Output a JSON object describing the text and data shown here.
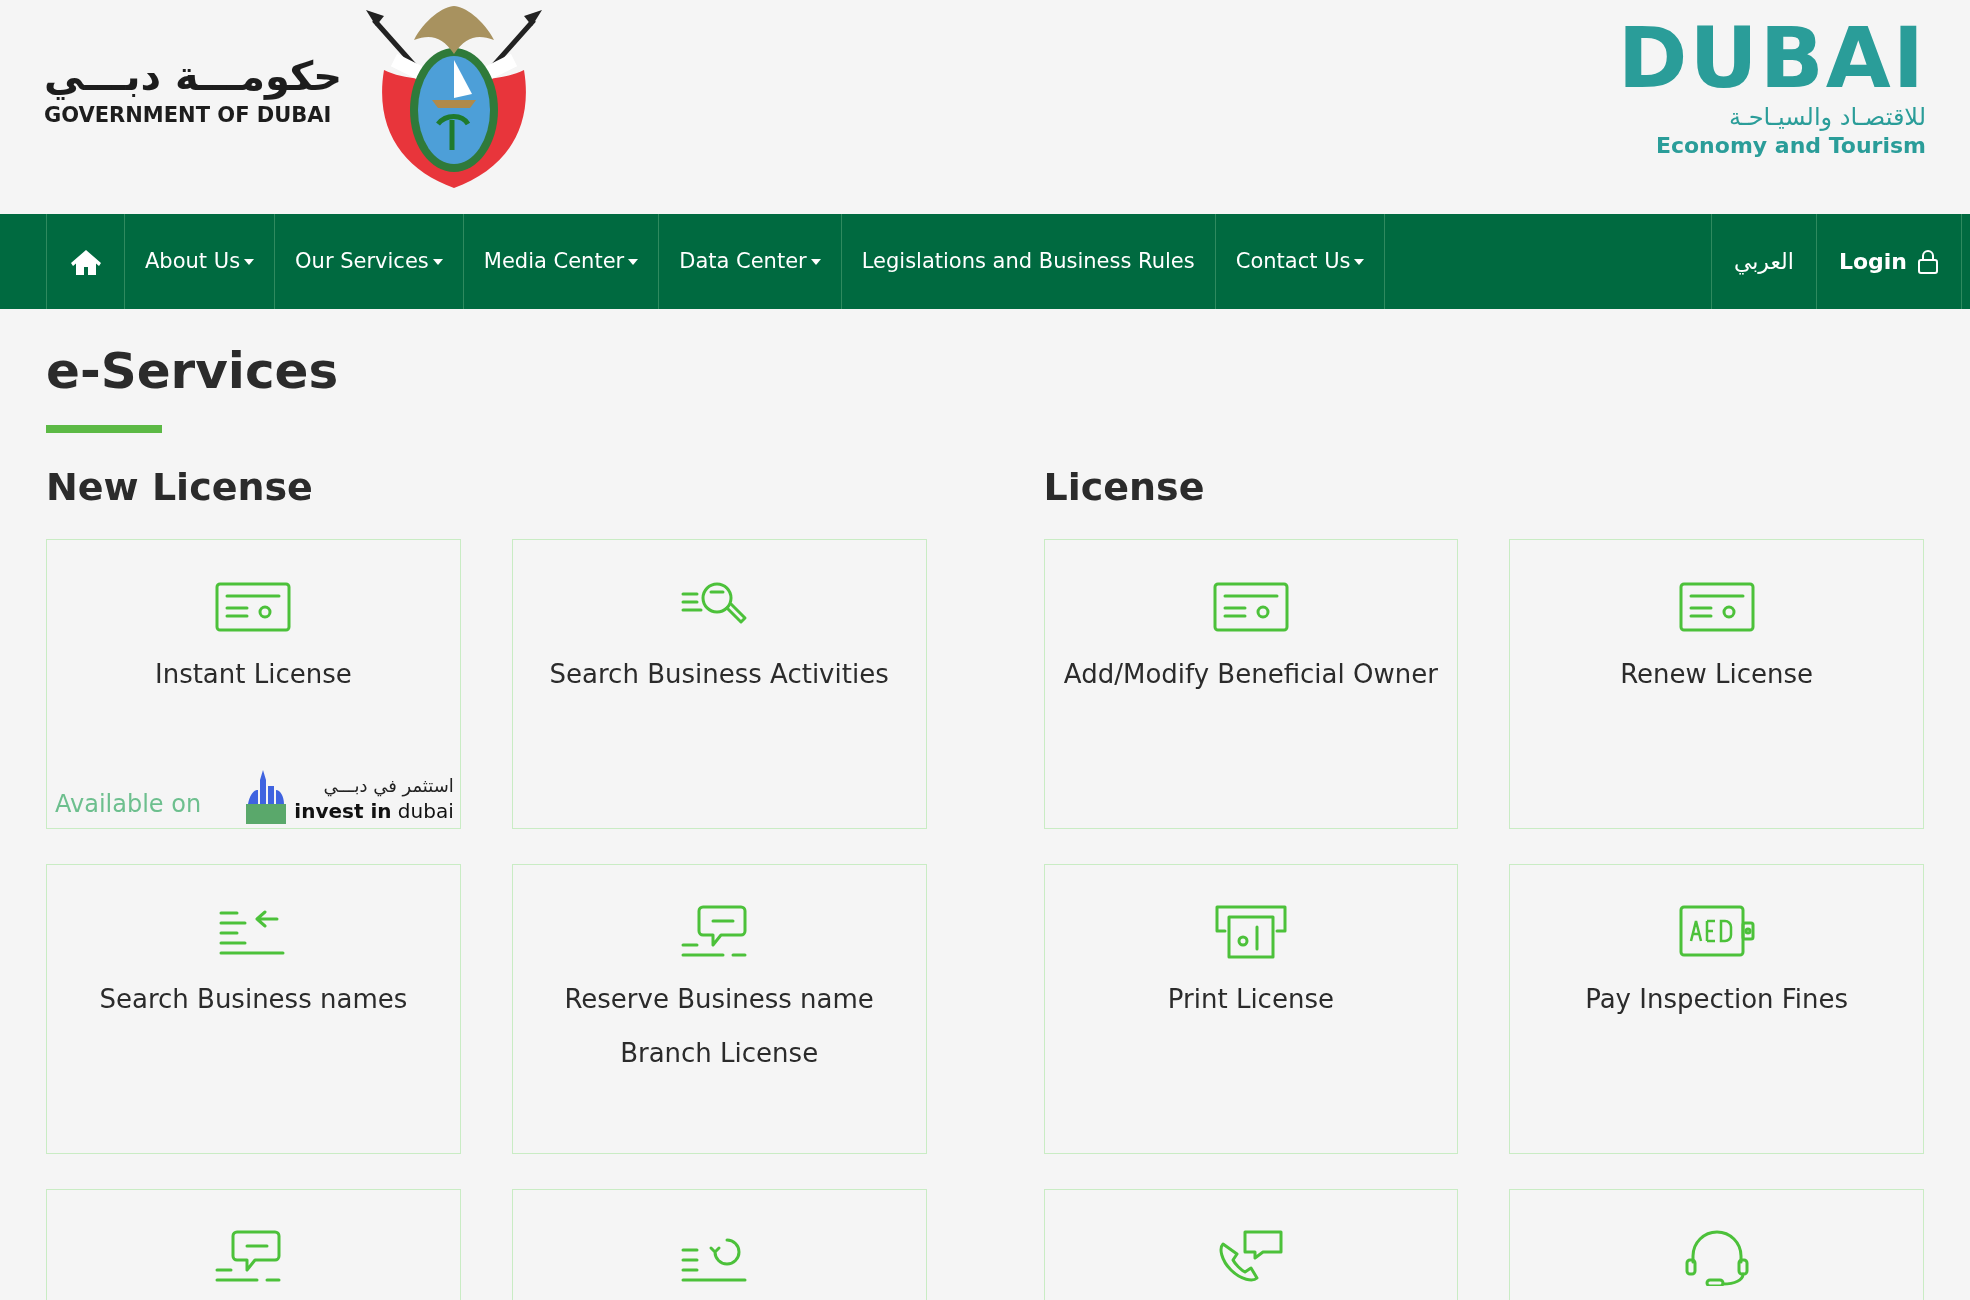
{
  "header": {
    "gov_logo": {
      "arabic": "حكومـــة دبـــي",
      "english": "GOVERNMENT OF DUBAI"
    },
    "det_logo": {
      "wordmark": "DUBAI",
      "arabic": "للاقتصـاد والسيـاحـة",
      "english": "Economy and Tourism"
    }
  },
  "nav": {
    "items": [
      {
        "label": "About Us",
        "dropdown": true
      },
      {
        "label": "Our Services",
        "dropdown": true
      },
      {
        "label": "Media Center",
        "dropdown": true
      },
      {
        "label": "Data Center",
        "dropdown": true
      },
      {
        "label": "Legislations and Business Rules",
        "dropdown": false
      },
      {
        "label": "Contact Us",
        "dropdown": true
      }
    ],
    "language": "العربي",
    "login": "Login"
  },
  "page_title": "e-Services",
  "sections": [
    {
      "title": "New License",
      "cards": [
        {
          "kind": "license",
          "lines": [
            "Instant License"
          ],
          "badge": {
            "prefix": "Available on",
            "arabic": "استثمر في دبـــي",
            "brand": "**invest in** dubai"
          }
        },
        {
          "kind": "search",
          "lines": [
            "Search Business Activities"
          ]
        },
        {
          "kind": "listArrow",
          "lines": [
            "Search Business names"
          ]
        },
        {
          "kind": "chat",
          "lines": [
            "Reserve Business name",
            "Branch License"
          ]
        },
        {
          "kind": "chat"
        },
        {
          "kind": "refresh"
        }
      ]
    },
    {
      "title": "License",
      "cards": [
        {
          "kind": "license",
          "lines": [
            "Add/Modify Beneficial Owner"
          ]
        },
        {
          "kind": "license",
          "lines": [
            "Renew License"
          ]
        },
        {
          "kind": "print",
          "lines": [
            "Print License"
          ]
        },
        {
          "kind": "aed",
          "lines": [
            "Pay Inspection Fines"
          ]
        },
        {
          "kind": "phone"
        },
        {
          "kind": "headset"
        }
      ]
    }
  ]
}
